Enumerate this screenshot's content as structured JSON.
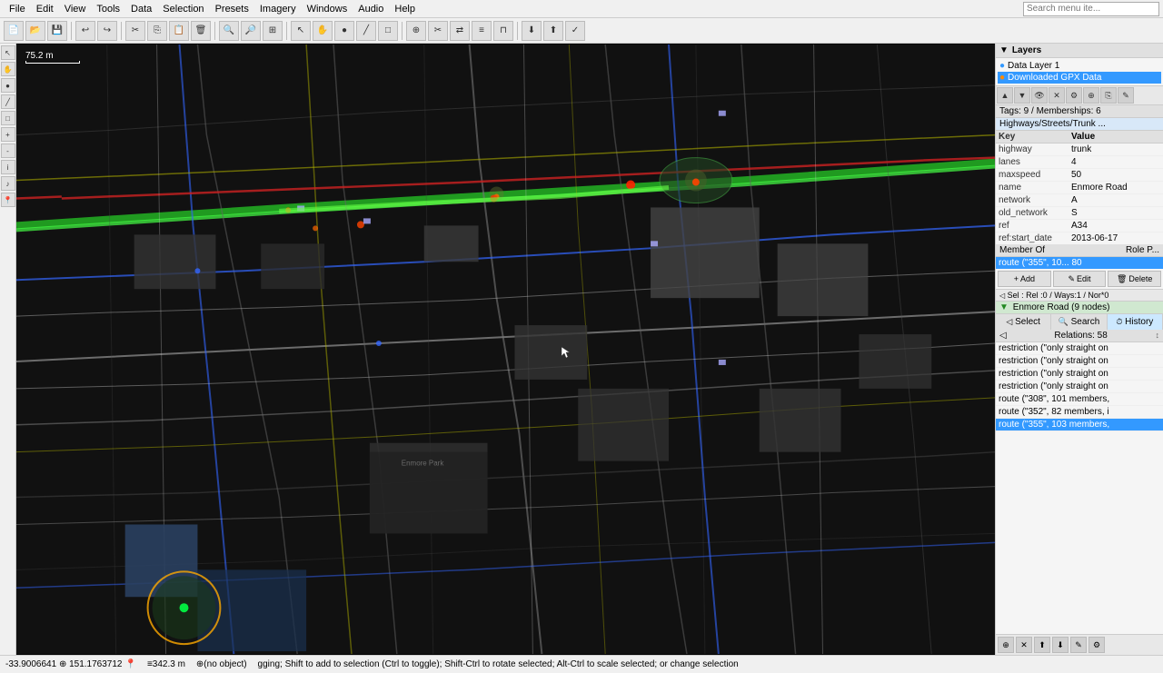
{
  "menubar": {
    "items": [
      "File",
      "Edit",
      "View",
      "Tools",
      "Data",
      "Selection",
      "Presets",
      "Imagery",
      "Windows",
      "Audio",
      "Help"
    ],
    "search_placeholder": "Search menu ite..."
  },
  "toolbar": {
    "buttons": [
      "new",
      "open",
      "save",
      "undo",
      "redo",
      "cut",
      "copy",
      "paste",
      "delete",
      "zoom-in",
      "zoom-out",
      "zoom-fit",
      "select",
      "move",
      "draw-node",
      "draw-way",
      "draw-area",
      "merge",
      "split",
      "reverse",
      "align",
      "distribute",
      "ortho",
      "download",
      "upload",
      "validate"
    ]
  },
  "map": {
    "scale_text": "75.2 m",
    "scale_width": 60
  },
  "layers": {
    "header": "Layers",
    "items": [
      {
        "label": "Data Layer 1",
        "checked": true,
        "color": "#4488ff"
      },
      {
        "label": "Downloaded GPX Data",
        "checked": true,
        "color": "#ff8800"
      }
    ]
  },
  "properties": {
    "tags_header": "Tags: 9 / Memberships: 6",
    "way_header": "Highways/Streets/Trunk ...",
    "key_header": "Key",
    "value_header": "Value",
    "tags": [
      {
        "key": "highway",
        "value": "trunk"
      },
      {
        "key": "lanes",
        "value": "4"
      },
      {
        "key": "maxspeed",
        "value": "50"
      },
      {
        "key": "name",
        "value": "Enmore Road"
      },
      {
        "key": "network",
        "value": "A"
      },
      {
        "key": "old_network",
        "value": "S"
      },
      {
        "key": "ref",
        "value": "A34"
      },
      {
        "key": "ref:start_date",
        "value": "2013-06-17"
      }
    ],
    "members_header": "Member Of",
    "members_role_header": "Role P...",
    "member_row": "route (\"355\", 10...       80",
    "buttons": {
      "add": "Add",
      "edit": "Edit",
      "delete": "Delete"
    }
  },
  "selection_info": {
    "text": "Sel : Rel :0 / Ways:1 / Nor*0",
    "way_label": "Enmore Road (9 nodes)"
  },
  "bottom_tabs": {
    "tabs": [
      "Select",
      "Search",
      "History"
    ]
  },
  "relations": {
    "header": "Relations: 58",
    "items": [
      {
        "text": "restriction (\"only straight on",
        "selected": false
      },
      {
        "text": "restriction (\"only straight on",
        "selected": false
      },
      {
        "text": "restriction (\"only straight on",
        "selected": false
      },
      {
        "text": "restriction (\"only straight on",
        "selected": false
      },
      {
        "text": "route (\"308\", 101 members,",
        "selected": false
      },
      {
        "text": "route (\"352\", 82 members, i",
        "selected": false
      },
      {
        "text": "route (\"355\", 103 members,",
        "selected": true
      }
    ]
  },
  "statusbar": {
    "coordinates": "-33.9006641  ⊕ 151.1763712",
    "distance": "≡342.3 m",
    "selection": "⊕(no object)",
    "hint": "gging; Shift to add to selection (Ctrl to toggle); Shift-Ctrl to rotate selected; Alt-Ctrl to scale selected; or change selection"
  }
}
